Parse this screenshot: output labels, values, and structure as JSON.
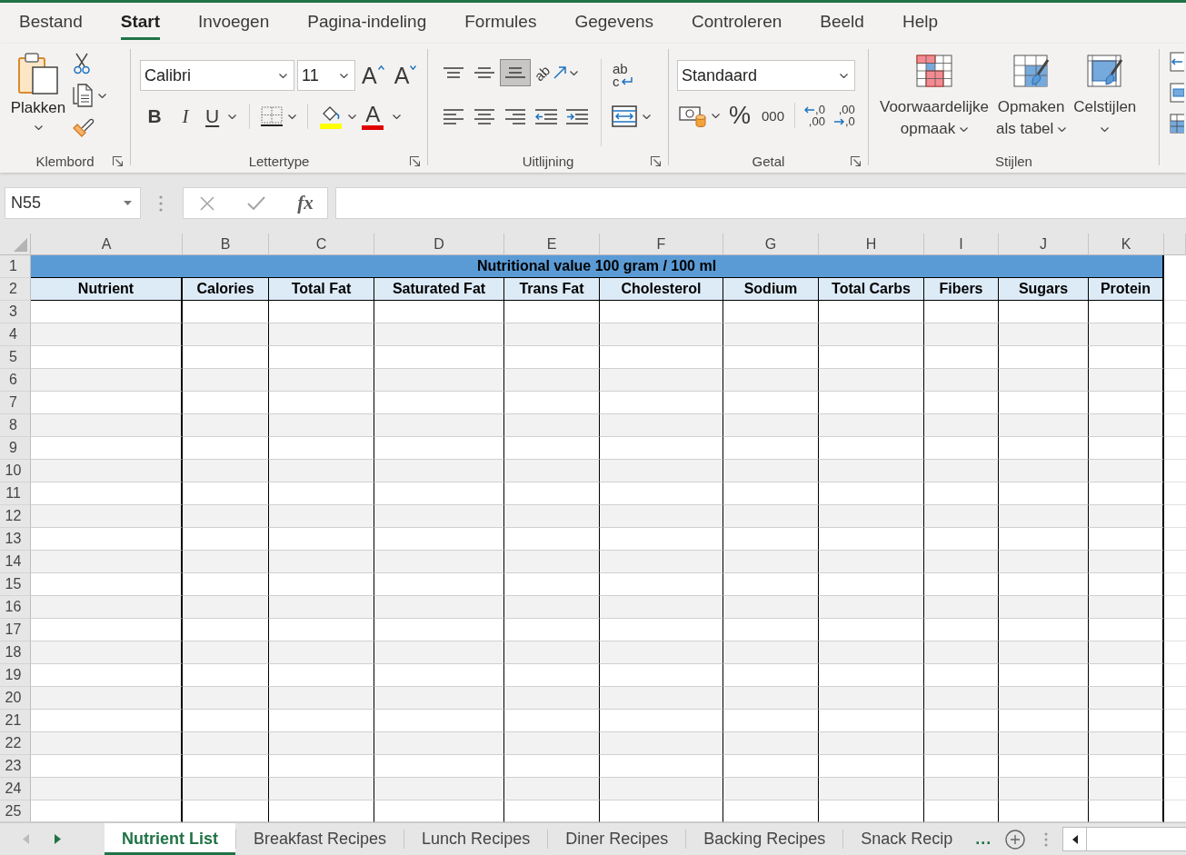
{
  "menu_tabs": [
    {
      "label": "Bestand",
      "selected": false
    },
    {
      "label": "Start",
      "selected": true
    },
    {
      "label": "Invoegen",
      "selected": false
    },
    {
      "label": "Pagina-indeling",
      "selected": false
    },
    {
      "label": "Formules",
      "selected": false
    },
    {
      "label": "Gegevens",
      "selected": false
    },
    {
      "label": "Controleren",
      "selected": false
    },
    {
      "label": "Beeld",
      "selected": false
    },
    {
      "label": "Help",
      "selected": false
    }
  ],
  "ribbon": {
    "clipboard": {
      "title": "Klembord",
      "paste_label": "Plakken"
    },
    "font": {
      "title": "Lettertype",
      "font_name": "Calibri",
      "font_size": "11",
      "grow_glyph": "A",
      "shrink_glyph": "A",
      "styles": [
        {
          "kind": "bold",
          "label": "B"
        },
        {
          "kind": "italic",
          "label": "I"
        },
        {
          "kind": "underline",
          "label": "U"
        }
      ],
      "font_color_glyph": "A"
    },
    "alignment": {
      "title": "Uitlijning",
      "vertical": [
        {
          "kind": "top",
          "selected": false
        },
        {
          "kind": "middle",
          "selected": false
        },
        {
          "kind": "bottom",
          "selected": true
        }
      ],
      "orientation_glyph": "ab",
      "horizontal": [
        {
          "kind": "left",
          "selected": false
        },
        {
          "kind": "center",
          "selected": false
        },
        {
          "kind": "right",
          "selected": false
        }
      ],
      "wrap_lines": [
        "ab",
        "c"
      ]
    },
    "number": {
      "title": "Getal",
      "format": "Standaard",
      "percent_glyph": "%",
      "comma_glyph": "000",
      "decimals": [
        {
          "kind": "increase",
          "lines": [
            ",0",
            ",00"
          ]
        },
        {
          "kind": "decrease",
          "lines": [
            ",00",
            ",0"
          ]
        }
      ]
    },
    "styles": {
      "title": "Stijlen",
      "buttons": [
        {
          "kind": "conditional",
          "lines": [
            "Voorwaardelijke",
            "opmaak"
          ]
        },
        {
          "kind": "table",
          "lines": [
            "Opmaken",
            "als tabel"
          ]
        },
        {
          "kind": "cell",
          "lines": [
            "Celstijlen"
          ]
        }
      ]
    }
  },
  "formula_bar": {
    "name_box": "N55",
    "function_glyph": "fx"
  },
  "sheet": {
    "column_letters": [
      "A",
      "B",
      "C",
      "D",
      "E",
      "F",
      "G",
      "H",
      "I",
      "J",
      "K"
    ],
    "row_numbers": [
      "1",
      "2",
      "3",
      "4",
      "5",
      "6",
      "7",
      "8",
      "9",
      "10",
      "11",
      "12",
      "13",
      "14",
      "15",
      "16",
      "17",
      "18",
      "19",
      "20",
      "21",
      "22",
      "23",
      "24",
      "25"
    ],
    "title": "Nutritional value 100 gram / 100 ml",
    "headers": [
      "Nutrient",
      "Calories",
      "Total Fat",
      "Saturated Fat",
      "Trans Fat",
      "Cholesterol",
      "Sodium",
      "Total Carbs",
      "Fibers",
      "Sugars",
      "Protein"
    ]
  },
  "sheet_tabs": {
    "nav": [
      {
        "kind": "previous",
        "disabled": true
      },
      {
        "kind": "next",
        "disabled": false
      }
    ],
    "tabs": [
      {
        "label": "Nutrient List",
        "selected": true
      },
      {
        "label": "Breakfast Recipes",
        "selected": false
      },
      {
        "label": "Lunch Recipes",
        "selected": false
      },
      {
        "label": "Diner Recipes",
        "selected": false
      },
      {
        "label": "Backing Recipes",
        "selected": false
      },
      {
        "label": "Snack Recip",
        "selected": false
      }
    ],
    "more": "..."
  }
}
